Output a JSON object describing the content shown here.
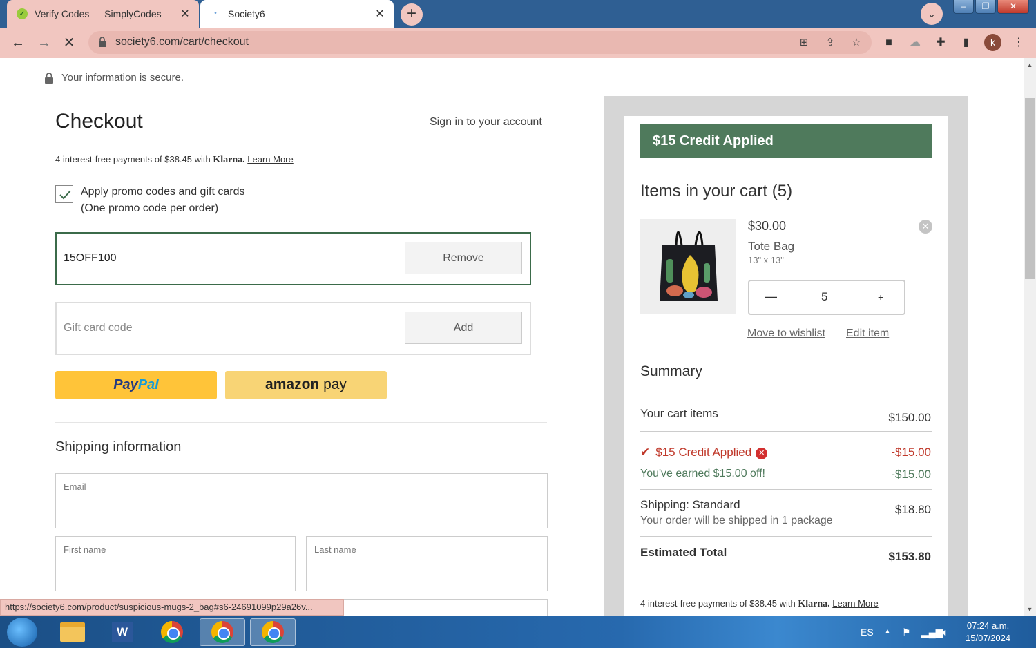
{
  "browser": {
    "tabs": [
      {
        "title": "Verify Codes — SimplyCodes"
      },
      {
        "title": "Society6"
      }
    ],
    "url": "society6.com/cart/checkout",
    "profile_initial": "k",
    "status_url": "https://society6.com/product/suspicious-mugs-2_bag#s6-24691099p29a26v..."
  },
  "page": {
    "secure_text": "Your information is secure.",
    "title": "Checkout",
    "signin_link": "Sign in to your account",
    "klarna_text": "4 interest-free payments of $38.45 with",
    "klarna_brand": "Klarna.",
    "klarna_learn_more": "Learn More",
    "promo_checkbox_label": "Apply promo codes and gift cards",
    "promo_checkbox_sublabel": "(One promo code per order)",
    "promo_checked": true,
    "promo_code_value": "15OFF100",
    "remove_label": "Remove",
    "gift_placeholder": "Gift card code",
    "add_label": "Add",
    "paypal_part1": "Pay",
    "paypal_part2": "Pal",
    "amazon_part1": "amazon",
    "amazon_part2": "pay",
    "shipping_title": "Shipping information",
    "email_label": "Email",
    "first_name_label": "First name",
    "last_name_label": "Last name"
  },
  "cart": {
    "credit_banner": "$15 Credit Applied",
    "title": "Items in your cart (5)",
    "item": {
      "price": "$30.00",
      "name": "Tote Bag",
      "size": "13\" x 13\"",
      "quantity": "5",
      "minus": "—",
      "plus": "+",
      "move_to_wishlist": "Move to wishlist",
      "edit_item": "Edit item"
    },
    "summary": {
      "title": "Summary",
      "cart_items_label": "Your cart items",
      "cart_items_value": "$150.00",
      "credit_label": "$15 Credit Applied",
      "credit_value": "-$15.00",
      "earned_label": "You've earned $15.00 off!",
      "earned_value": "-$15.00",
      "shipping_label": "Shipping: Standard",
      "shipping_sub": "Your order will be shipped in 1 package",
      "shipping_value": "$18.80",
      "total_label": "Estimated Total",
      "total_value": "$153.80"
    },
    "klarna_text": "4 interest-free payments of $38.45 with",
    "klarna_brand": "Klarna.",
    "klarna_learn_more": "Learn More"
  },
  "taskbar": {
    "language": "ES",
    "time": "07:24 a.m.",
    "date": "15/07/2024"
  },
  "colors": {
    "accent_green": "#4f7a5c",
    "credit_red": "#c0392b",
    "paypal_yellow": "#ffc439",
    "amazon_yellow": "#f8d475",
    "chrome_pink": "#f1c6c0"
  }
}
